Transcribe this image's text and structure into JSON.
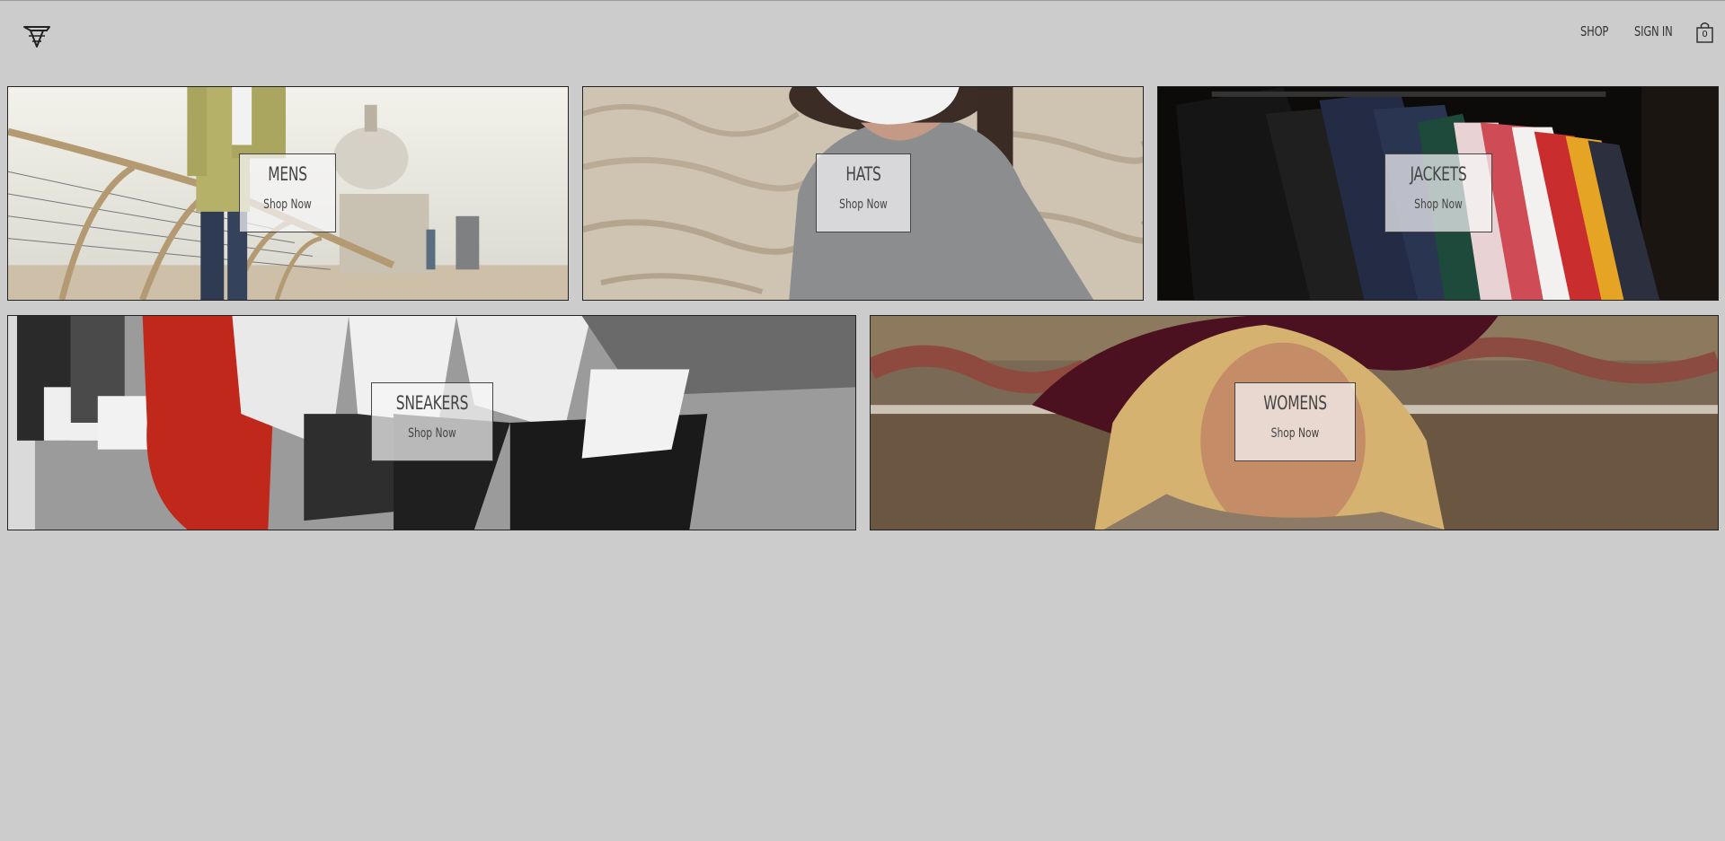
{
  "header": {
    "logo_icon": "brand-crown-logo",
    "nav": {
      "shop": "SHOP",
      "sign_in": "SIGN IN"
    },
    "cart": {
      "icon": "shopping-bag-icon",
      "count": "0"
    }
  },
  "categories": [
    {
      "title": "MENS",
      "cta": "Shop Now"
    },
    {
      "title": "HATS",
      "cta": "Shop Now"
    },
    {
      "title": "JACKETS",
      "cta": "Shop Now"
    },
    {
      "title": "SNEAKERS",
      "cta": "Shop Now"
    },
    {
      "title": "WOMENS",
      "cta": "Shop Now"
    }
  ]
}
